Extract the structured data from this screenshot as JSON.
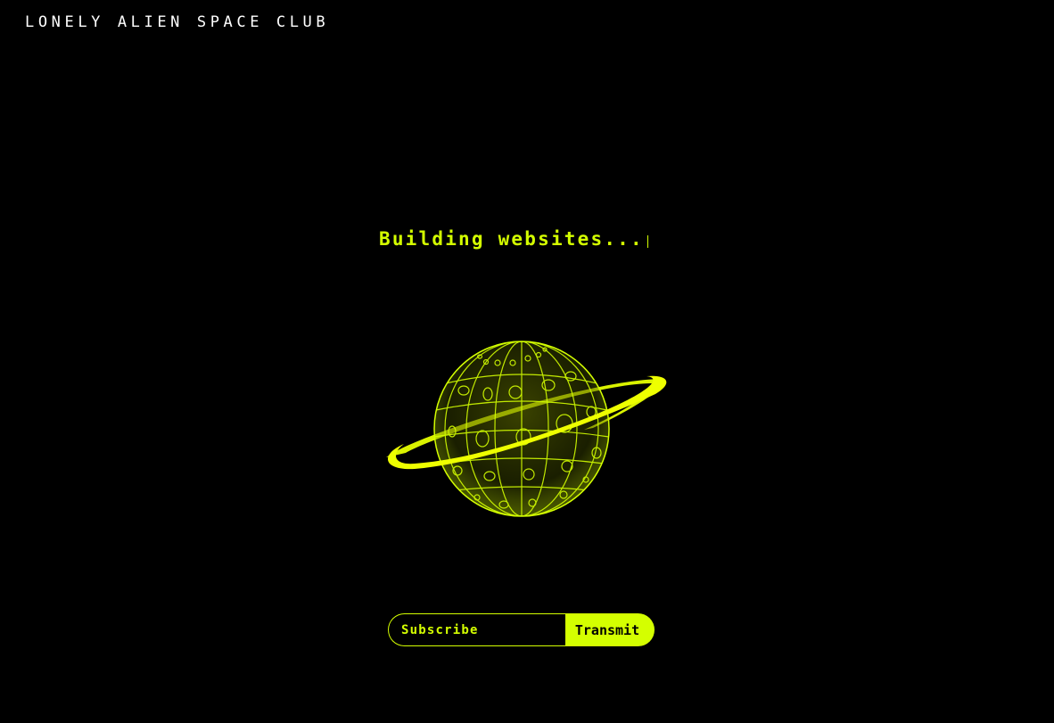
{
  "header": {
    "title": "LONELY ALIEN SPACE CLUB"
  },
  "hero": {
    "headline": "Building websites..."
  },
  "illustration": {
    "icon": "ringed-planet-icon",
    "color": "#d4ff00"
  },
  "subscribe": {
    "placeholder": "Subscribe",
    "button_label": "Transmit"
  },
  "colors": {
    "background": "#000000",
    "accent": "#d4ff00",
    "title": "#ffffff"
  }
}
